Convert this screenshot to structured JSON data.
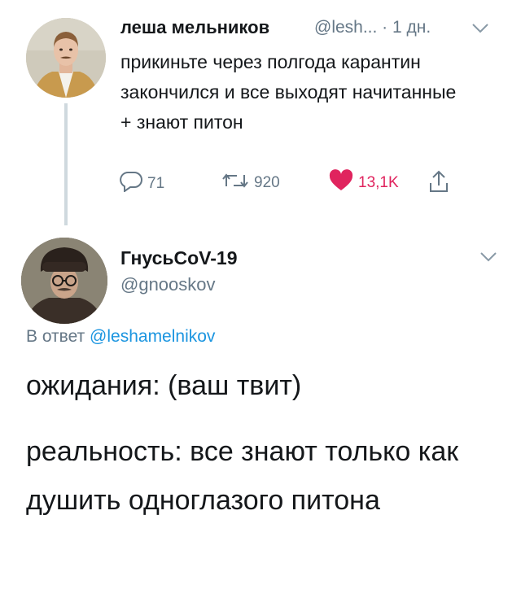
{
  "tweet": {
    "author_name": "леша мельников",
    "handle_meta": "@lesh... · 1 дн.",
    "text": "прикиньте через полгода карантин закончился и все выходят начитанные + знают питон",
    "actions": {
      "reply_count": "71",
      "retweet_count": "920",
      "like_count": "13,1K"
    },
    "icons": {
      "reply": "reply-icon",
      "retweet": "retweet-icon",
      "like": "heart-icon",
      "share": "share-icon",
      "menu": "chevron-down-icon"
    }
  },
  "reply": {
    "author_name": "ГнусьCoV-19",
    "handle": "@gnooskov",
    "reply_to_prefix": "В ответ",
    "reply_to_mention": "@leshamelnikov",
    "paragraph_1": "ожидания: (ваш твит)",
    "paragraph_2": "реальность: все знают только как душить одноглазого питона"
  },
  "colors": {
    "text": "#14171a",
    "secondary": "#657786",
    "link": "#1b95e0",
    "like": "#e0245e",
    "thread_line": "#cfd9de"
  }
}
